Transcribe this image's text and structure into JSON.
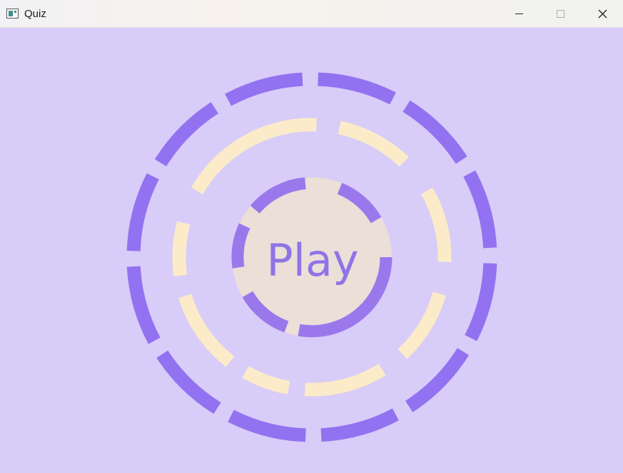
{
  "window": {
    "title": "Quiz",
    "icons": {
      "app": "app-window-icon",
      "minimize": "minimize-icon",
      "maximize": "maximize-icon",
      "close": "close-icon"
    }
  },
  "play": {
    "label": "Play"
  },
  "colors": {
    "background": "#d8ccf8",
    "outer_ring": "#9272f0",
    "middle_ring": "#fbebc9",
    "inner_ring": "#9a78ec",
    "center_fill": "#ebdfd8",
    "play_text": "#8e74e6"
  }
}
